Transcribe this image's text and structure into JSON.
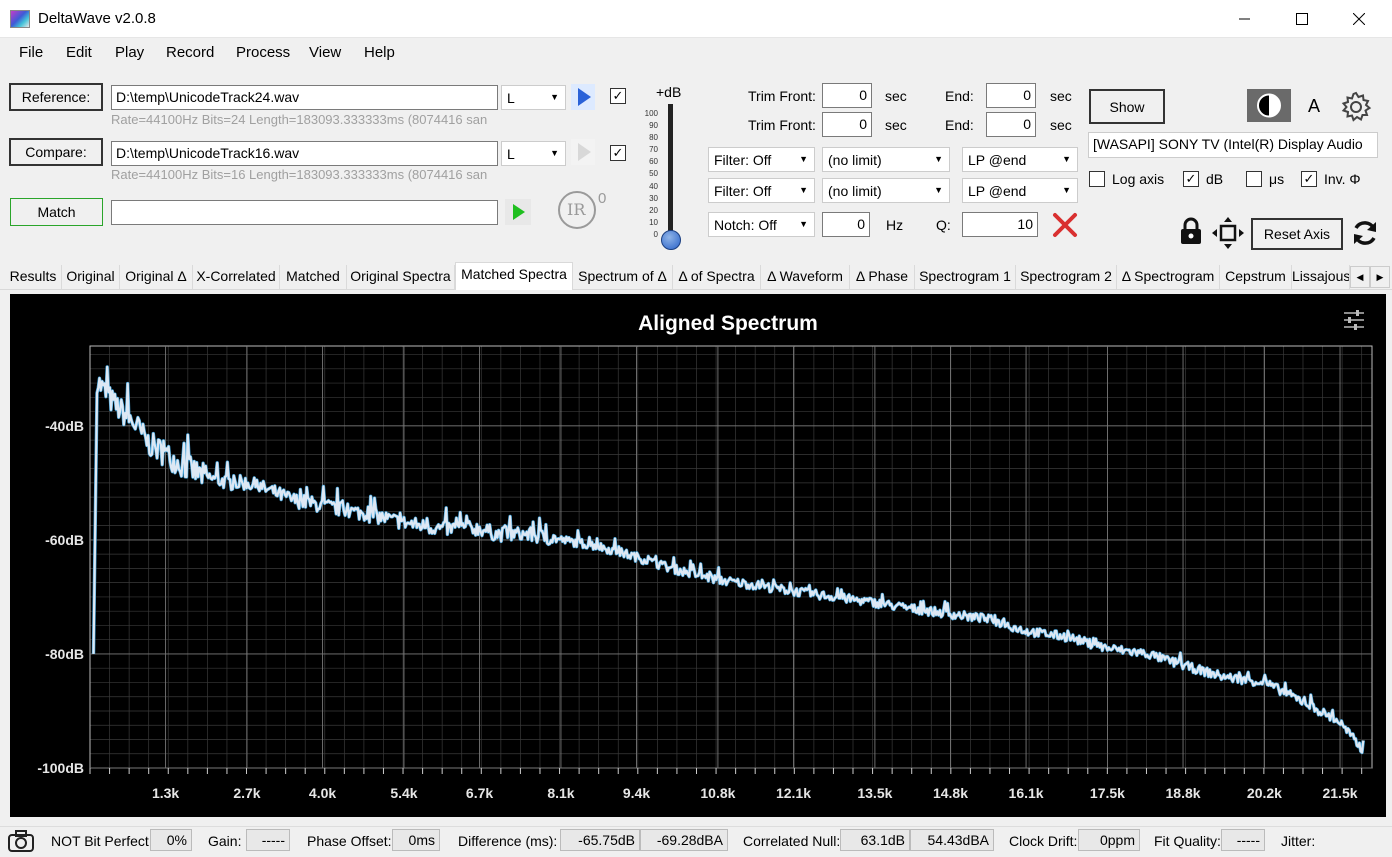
{
  "window": {
    "title": "DeltaWave v2.0.8"
  },
  "menu": [
    "File",
    "Edit",
    "Play",
    "Record",
    "Process",
    "View",
    "Help"
  ],
  "files": {
    "reference_label": "Reference:",
    "reference_path": "D:\\temp\\UnicodeTrack24.wav",
    "reference_channel": "L",
    "reference_info": "Rate=44100Hz Bits=24 Length=183093.333333ms (8074416 san",
    "compare_label": "Compare:",
    "compare_path": "D:\\temp\\UnicodeTrack16.wav",
    "compare_channel": "L",
    "compare_info": "Rate=44100Hz Bits=16 Length=183093.333333ms (8074416 san",
    "match_label": "Match",
    "match_value": ""
  },
  "ir": {
    "label": "IR",
    "count": "0"
  },
  "gain_slider": {
    "label": "+dB",
    "ticks": [
      "100",
      "90",
      "80",
      "70",
      "60",
      "50",
      "40",
      "30",
      "20",
      "10",
      "0"
    ]
  },
  "trim": {
    "front_label": "Trim Front:",
    "end_label": "End:",
    "unit": "sec",
    "row1": {
      "front": "0",
      "end": "0"
    },
    "row2": {
      "front": "0",
      "end": "0"
    }
  },
  "filters": {
    "row1": {
      "filter": "Filter: Off",
      "limit": "(no limit)",
      "lp": "LP @end"
    },
    "row2": {
      "filter": "Filter: Off",
      "limit": "(no limit)",
      "lp": "LP @end"
    },
    "notch": {
      "label": "Notch: Off",
      "hz_value": "0",
      "hz_unit": "Hz",
      "q_label": "Q:",
      "q_value": "10"
    }
  },
  "right_panel": {
    "show_label": "Show",
    "font_label": "A",
    "device": "[WASAPI] SONY TV (Intel(R) Display Audio",
    "checks": [
      {
        "label": "Log axis",
        "checked": false
      },
      {
        "label": "dB",
        "checked": true
      },
      {
        "label": "μs",
        "checked": false
      },
      {
        "label": "Inv. Φ",
        "checked": true
      }
    ],
    "reset_axis_label": "Reset Axis"
  },
  "tabs": [
    "Results",
    "Original",
    "Original Δ",
    "X-Correlated",
    "Matched",
    "Original Spectra",
    "Matched Spectra",
    "Spectrum of Δ",
    "Δ of Spectra",
    "Δ Waveform",
    "Δ Phase",
    "Spectrogram 1",
    "Spectrogram 2",
    "Δ Spectrogram",
    "Cepstrum",
    "Lissajous"
  ],
  "active_tab": "Matched Spectra",
  "chart_data": {
    "type": "line",
    "title": "Aligned Spectrum",
    "xlabel": "",
    "ylabel": "",
    "x_ticks": [
      "1.3k",
      "2.7k",
      "4.0k",
      "5.4k",
      "6.7k",
      "8.1k",
      "9.4k",
      "10.8k",
      "12.1k",
      "13.5k",
      "14.8k",
      "16.1k",
      "17.5k",
      "18.8k",
      "20.2k",
      "21.5k"
    ],
    "y_ticks": [
      "-40dB",
      "-60dB",
      "-80dB",
      "-100dB"
    ],
    "xlim": [
      0,
      22050
    ],
    "ylim": [
      -100,
      -26
    ],
    "grid": true,
    "series": [
      {
        "color": "#dde8f4",
        "x": [
          60,
          120,
          250,
          400,
          600,
          800,
          1000,
          1300,
          1600,
          2000,
          2400,
          2700,
          3000,
          3500,
          4000,
          4500,
          5000,
          5400,
          6000,
          6700,
          7000,
          7500,
          8100,
          8700,
          9400,
          10000,
          10800,
          11500,
          12100,
          12800,
          13500,
          14100,
          14800,
          15500,
          16100,
          16800,
          17500,
          18200,
          18800,
          19500,
          20200,
          20800,
          21500,
          21900
        ],
        "y": [
          -80,
          -32,
          -34,
          -36,
          -38,
          -40,
          -43,
          -45,
          -47,
          -49,
          -50,
          -50,
          -51,
          -53,
          -54,
          -55,
          -56,
          -57,
          -58,
          -58,
          -59,
          -59,
          -60,
          -61,
          -63,
          -65,
          -67,
          -68,
          -69,
          -70,
          -71,
          -72,
          -73,
          -74,
          -76,
          -77,
          -79,
          -80,
          -82,
          -84,
          -85,
          -88,
          -92,
          -97
        ]
      }
    ]
  },
  "status": {
    "bit_perfect": "NOT Bit Perfect",
    "bit_perfect_value": "0%",
    "gain_label": "Gain:",
    "gain_value": "-----",
    "phase_label": "Phase Offset:",
    "phase_value": "0ms",
    "diff_label": "Difference (ms):",
    "diff_db": "-65.75dB",
    "diff_dba": "-69.28dBA",
    "null_label": "Correlated Null:",
    "null_db": "63.1dB",
    "null_dba": "54.43dBA",
    "drift_label": "Clock Drift:",
    "drift_value": "0ppm",
    "fit_label": "Fit Quality:",
    "fit_value": "-----",
    "jitter_label": "Jitter:"
  },
  "colors": {
    "chart_bg": "#000000",
    "trace": "#dde8f4",
    "trace_edge": "#3fa0d8",
    "match_border": "#2aa52a",
    "play_blue": "#2a62d8",
    "play_green": "#1fbf1f",
    "clear_red": "#d93030"
  }
}
